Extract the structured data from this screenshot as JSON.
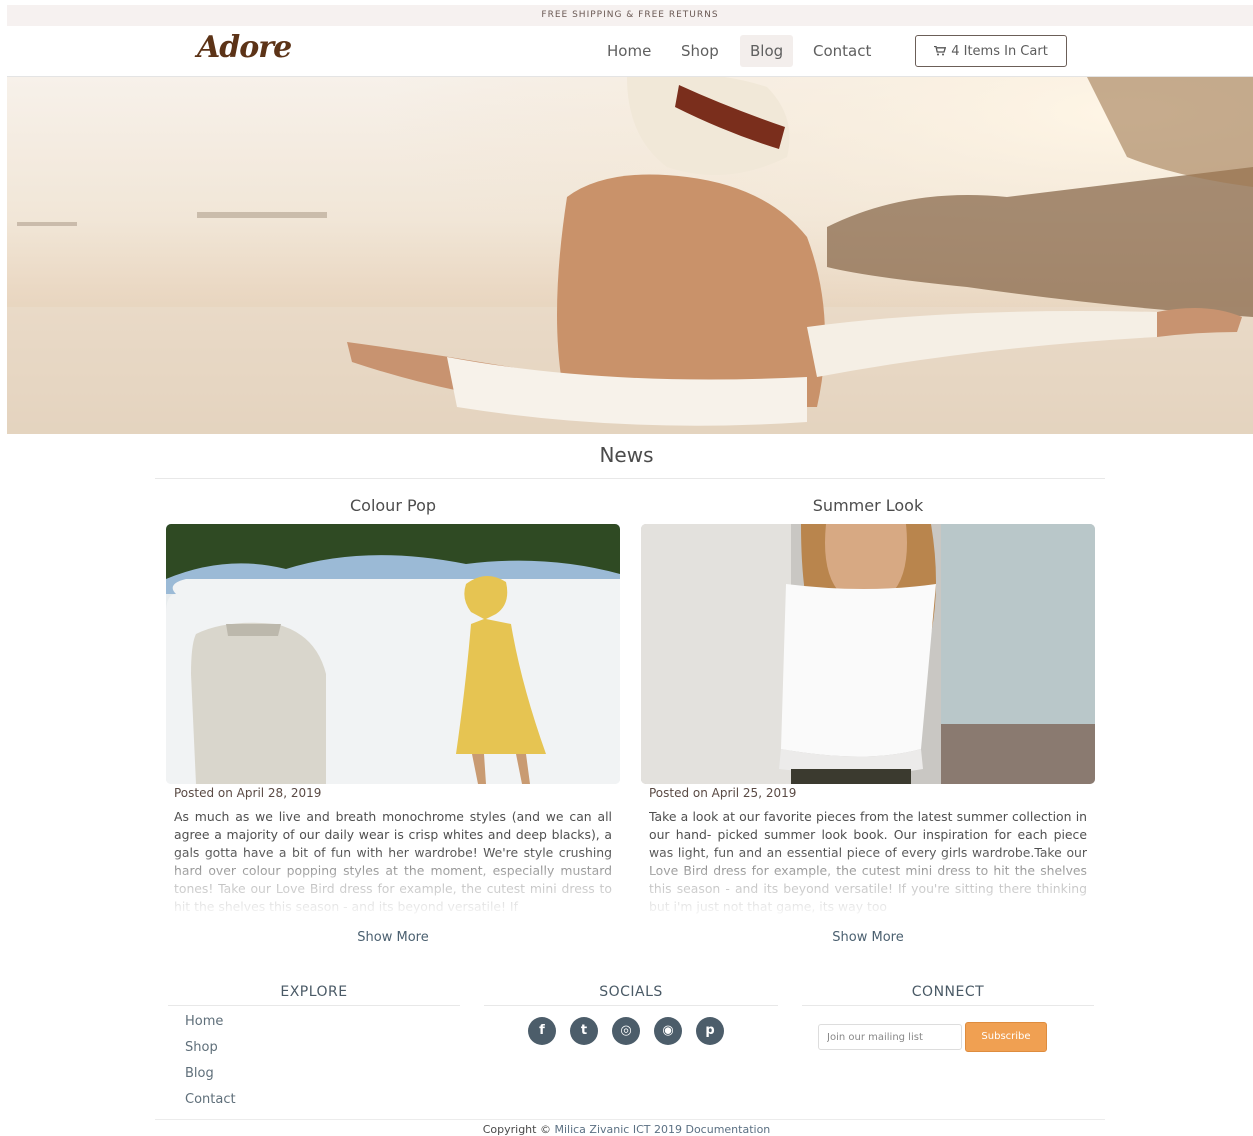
{
  "topbar": {
    "text": "FREE SHIPPING & FREE RETURNS"
  },
  "brand": {
    "logo": "Adore"
  },
  "nav": {
    "items": [
      {
        "label": "Home"
      },
      {
        "label": "Shop"
      },
      {
        "label": "Blog",
        "active": true
      },
      {
        "label": "Contact"
      }
    ],
    "cart_label": "4 Items In Cart",
    "cart_icon": "shopping-cart-icon"
  },
  "news": {
    "title": "News",
    "posts": [
      {
        "title": "Colour Pop",
        "date": "Posted on April 28, 2019",
        "body": "As much as we live and breath monochrome styles (and we can all agree a majority of our daily wear is crisp whites and deep blacks), a gals gotta have a bit of fun with her wardrobe! We're style crushing hard over colour popping styles at the moment, especially mustard tones! Take our Love Bird dress for example, the cutest mini dress to hit the shelves this season - and its beyond versatile! If",
        "show_more": "Show More"
      },
      {
        "title": "Summer Look",
        "date": "Posted on April 25, 2019",
        "body": "Take a look at our favorite pieces from the latest summer collection in our hand- picked summer look book. Our inspiration for each piece was light, fun and an essential piece of every girls wardrobe.Take our Love Bird dress for example, the cutest mini dress to hit the shelves this season - and its beyond versatile! If you're sitting there thinking but i'm just not that game, its way too",
        "show_more": "Show More"
      }
    ]
  },
  "footer": {
    "explore": {
      "heading": "EXPLORE",
      "links": [
        "Home",
        "Shop",
        "Blog",
        "Contact"
      ]
    },
    "socials": {
      "heading": "SOCIALS",
      "icons": [
        "facebook-icon",
        "twitter-icon",
        "instagram-icon",
        "snapchat-icon",
        "pinterest-icon"
      ],
      "glyphs": [
        "f",
        "t",
        "◎",
        "◉",
        "p"
      ]
    },
    "connect": {
      "heading": "CONNECT",
      "placeholder": "Join our mailing list",
      "button": "Subscribe"
    },
    "copyright": {
      "prefix": "Copyright ©",
      "author": "Milica Zivanic ICT 2019",
      "doc_link": "Documentation"
    }
  },
  "colors": {
    "accent": "#f0a052",
    "brand": "#5c3317",
    "social": "#4c5d6a"
  }
}
